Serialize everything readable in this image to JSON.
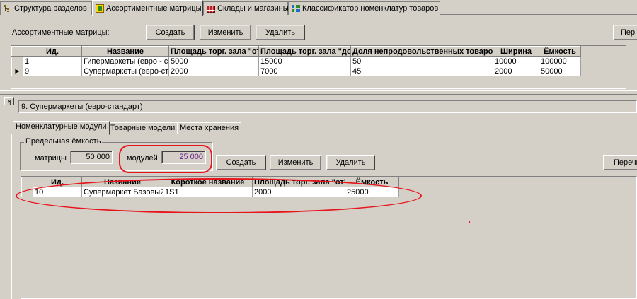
{
  "top_tabs": [
    {
      "label": "Структура разделов",
      "icon": "tree-icon"
    },
    {
      "label": "Ассортиментные матрицы",
      "icon": "matrix-icon",
      "active": true
    },
    {
      "label": "Склады и магазины",
      "icon": "warehouse-icon"
    },
    {
      "label": "Классификатор номенклатур товаров",
      "icon": "classifier-icon"
    }
  ],
  "matrices": {
    "label": "Ассортиментные матрицы:",
    "buttons": {
      "create": "Создать",
      "edit": "Изменить",
      "delete": "Удалить",
      "more": "Пер"
    },
    "columns": [
      "Ид.",
      "Название",
      "Площадь торг. зала \"от\"",
      "Площадь торг. зала \"до\"",
      "Доля непродовольственных товаров",
      "Ширина",
      "Ёмкость"
    ],
    "rows": [
      [
        "1",
        "Гипермаркеты (евро - ста",
        "5000",
        "15000",
        "50",
        "10000",
        "100000"
      ],
      [
        "9",
        "Супермаркеты (евро-стан",
        "2000",
        "7000",
        "45",
        "2000",
        "50000"
      ]
    ],
    "current_row_indicator": "▶"
  },
  "pin_label": "ʞ",
  "selected_matrix": "9. Супермаркеты (евро-стандарт)",
  "lower_tabs": [
    "Номенклатурные модули",
    "Товарные модели",
    "Места хранения"
  ],
  "capacity": {
    "legend": "Предельная ёмкость",
    "matrix_label": "матрицы",
    "matrix_value": "50 000",
    "modules_label": "модулей",
    "modules_value": "25 000"
  },
  "modules": {
    "buttons": {
      "create": "Создать",
      "edit": "Изменить",
      "delete": "Удалить",
      "more": "Перечи"
    },
    "columns": [
      "Ид.",
      "Название",
      "Короткое название",
      "Площадь торг. зала \"от\"",
      "Ёмкость"
    ],
    "rows": [
      [
        "10",
        "Супермаркет Базовый",
        "1S1",
        "2000",
        "25000"
      ]
    ]
  },
  "colors": {
    "annotation": "#e8141c",
    "modules_value": "#6a1e8a"
  }
}
